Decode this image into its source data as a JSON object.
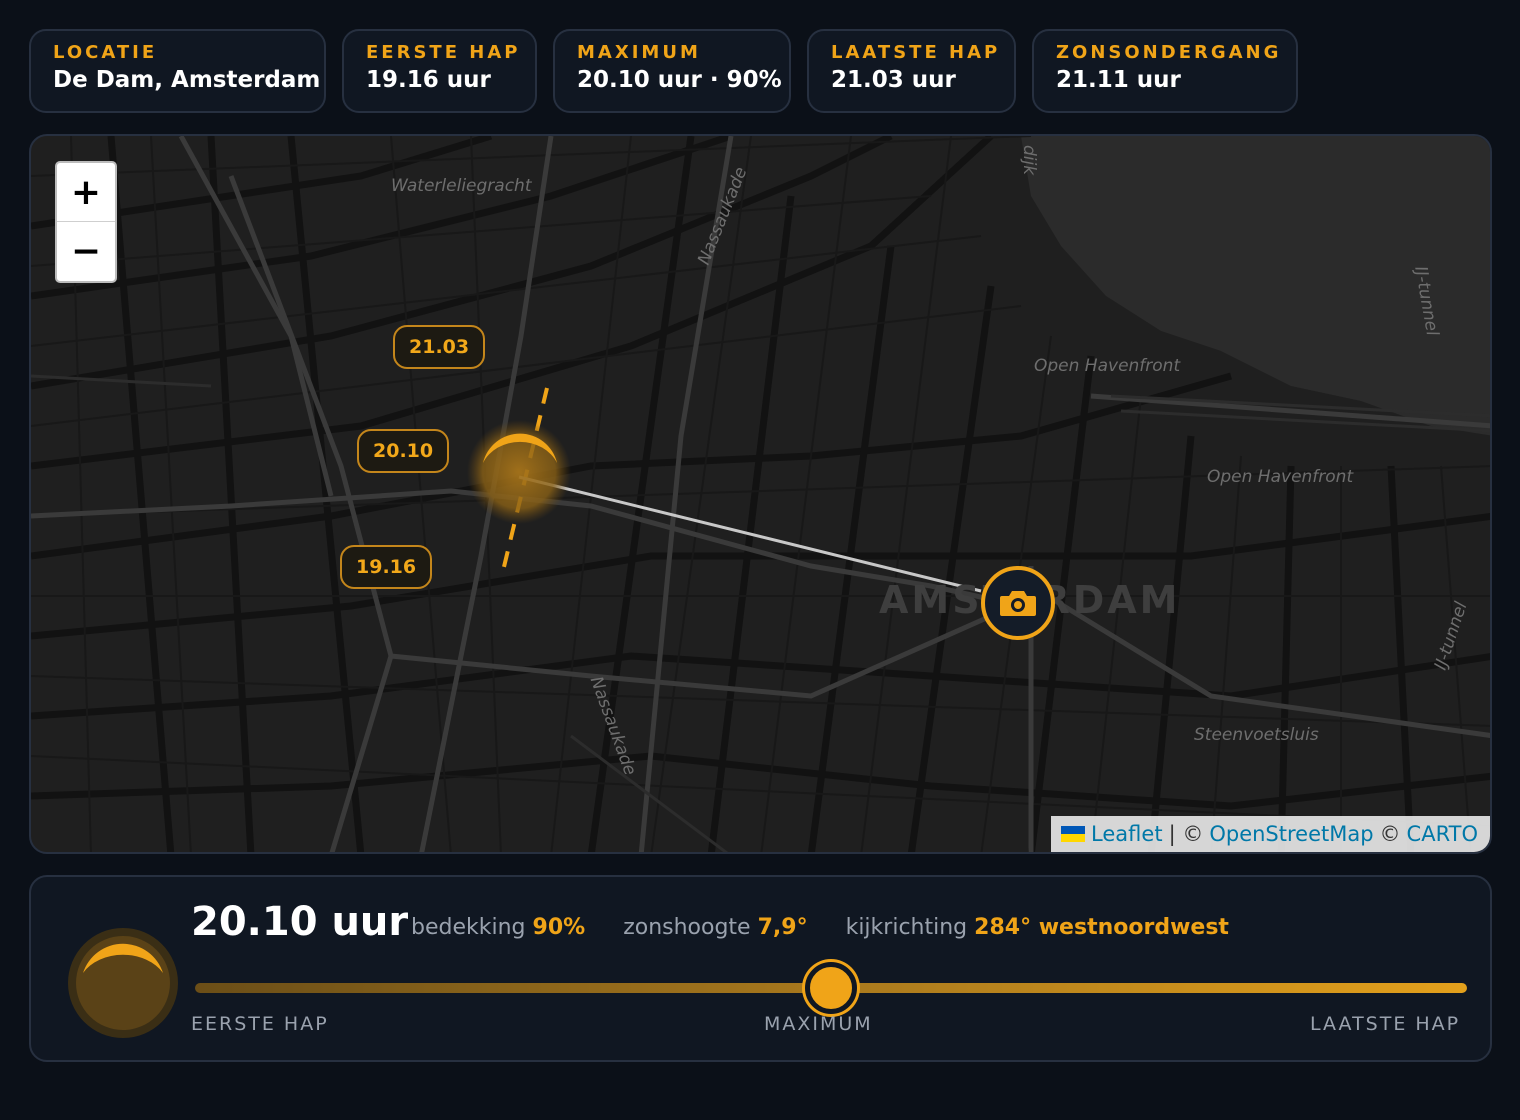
{
  "stats": [
    {
      "label": "LOCATIE",
      "value": "De Dam, Amsterdam"
    },
    {
      "label": "EERSTE HAP",
      "value": "19.16 uur"
    },
    {
      "label": "MAXIMUM",
      "value": "20.10 uur · 90%"
    },
    {
      "label": "LAATSTE HAP",
      "value": "21.03 uur"
    },
    {
      "label": "ZONSONDERGANG",
      "value": "21.11 uur"
    }
  ],
  "map": {
    "zoom_in": "+",
    "zoom_out": "−",
    "time_labels": {
      "end": "21.03",
      "max": "20.10",
      "start": "19.16"
    },
    "streets": {
      "waterleliegracht": "Waterleliegracht",
      "nassaukade_top": "Nassaukade",
      "nassaukade_bottom": "Nassaukade",
      "havenfront_1": "Open Havenfront",
      "havenfront_2": "Open Havenfront",
      "ij_tunnel_1": "IJ-tunnel",
      "ij_tunnel_2": "IJ-tunnel",
      "steenvoetsluis": "Steenvoetsluis",
      "dijk": "dijk"
    },
    "city_label": "AMSTERDAM",
    "attribution": {
      "leaflet": "Leaflet",
      "separator": "| ©",
      "osm": "OpenStreetMap",
      "copy": "©",
      "carto": "CARTO"
    },
    "colors": {
      "accent": "#f0a418",
      "sightline": "#c8c8c8"
    }
  },
  "panel": {
    "time": "20.10 uur",
    "coverage_label": "bedekking",
    "coverage_value": "90%",
    "altitude_label": "zonshoogte",
    "altitude_value": "7,9°",
    "direction_label": "kijkrichting",
    "direction_value": "284° westnoordwest",
    "slider_position": 0.5,
    "ticks": {
      "start": "EERSTE HAP",
      "mid": "MAXIMUM",
      "end": "LAATSTE HAP"
    }
  }
}
